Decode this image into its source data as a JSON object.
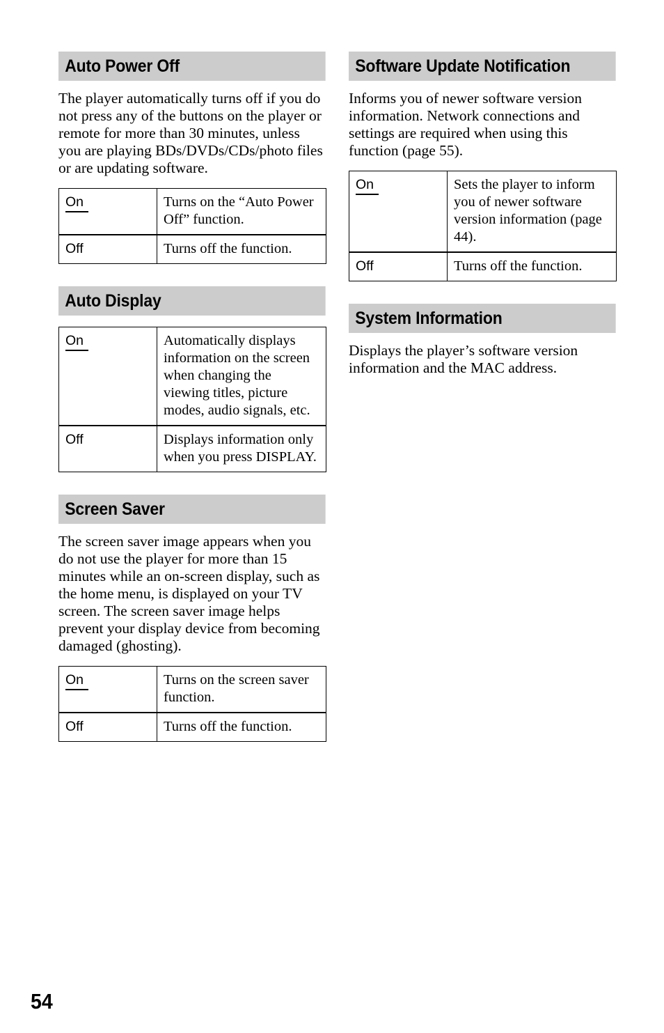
{
  "page": {
    "number": "54"
  },
  "columns": {
    "left": [
      {
        "id": "auto-power-off",
        "heading": "Auto Power Off",
        "body": "The player automatically turns off if you do not press any of the buttons on the player or remote for more than 30 minutes, unless you are playing BDs/DVDs/CDs/photo files or are updating software.",
        "table": {
          "rows": [
            {
              "key": "On",
              "default": true,
              "value": "Turns on the “Auto Power Off” function."
            },
            {
              "key": "Off",
              "default": false,
              "value": "Turns off the function."
            }
          ]
        }
      },
      {
        "id": "auto-display",
        "heading": "Auto Display",
        "body": "",
        "table": {
          "rows": [
            {
              "key": "On",
              "default": true,
              "value": "Automatically displays information on the screen when changing the viewing titles, picture modes, audio signals, etc."
            },
            {
              "key": "Off",
              "default": false,
              "value": "Displays information only when you press DISPLAY."
            }
          ]
        }
      },
      {
        "id": "screen-saver",
        "heading": "Screen Saver",
        "body": "The screen saver image appears when you do not use the player for more than 15 minutes while an on-screen display, such as the home menu, is displayed on your TV screen. The screen saver image helps prevent your display device from becoming damaged (ghosting).",
        "table": {
          "rows": [
            {
              "key": "On",
              "default": true,
              "value": "Turns on the screen saver function."
            },
            {
              "key": "Off",
              "default": false,
              "value": "Turns off the function."
            }
          ]
        }
      }
    ],
    "right": [
      {
        "id": "software-update-notification",
        "heading": "Software Update Notification",
        "body": "Informs you of newer software version information. Network connections and settings are required when using this function (page 55).",
        "table": {
          "rows": [
            {
              "key": "On",
              "default": true,
              "value": "Sets the player to inform you of newer software version information (page 44)."
            },
            {
              "key": "Off",
              "default": false,
              "value": "Turns off the function."
            }
          ]
        }
      },
      {
        "id": "system-information",
        "heading": "System Information",
        "body": "Displays the player’s software version information and the MAC address.",
        "table": null
      }
    ]
  },
  "colors": {
    "heading_background": "#cccccc",
    "text": "#000000",
    "page_background": "#ffffff",
    "table_border": "#000000"
  }
}
